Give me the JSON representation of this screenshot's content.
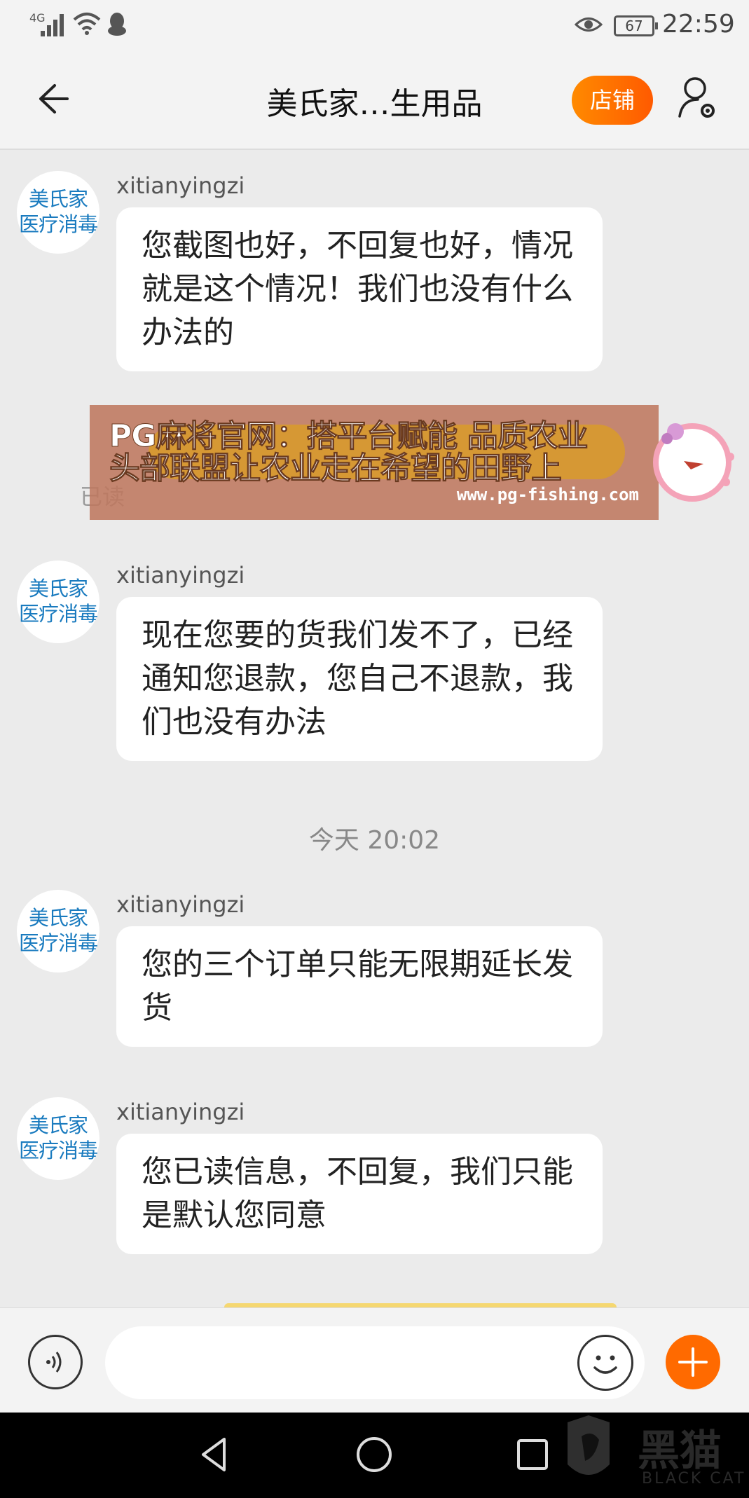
{
  "status_bar": {
    "network": "4G",
    "battery": "67",
    "time": "22:59"
  },
  "header": {
    "title": "美氏家…生用品",
    "shop_button": "店铺"
  },
  "avatar": {
    "line1": "美氏家",
    "line2": "医疗消毒"
  },
  "messages": [
    {
      "sender": "xitianyingzi",
      "text": "您截图也好，不回复也好，情况就是这个情况！我们也没有什么办法的"
    },
    {
      "sender": "xitianyingzi",
      "text": "现在您要的货我们发不了，已经通知您退款，您自己不退款，我们也没有办法"
    },
    {
      "sender": "xitianyingzi",
      "text": "您的三个订单只能无限期延长发货"
    },
    {
      "sender": "xitianyingzi",
      "text": "您已读信息，不回复，我们只能是默认您同意"
    }
  ],
  "read_status": "已读",
  "timestamp": "今天  20:02",
  "ad": {
    "line1": "PG麻将官网：搭平台赋能 品质农业",
    "line2": "头部联盟让农业走在希望的田野上",
    "url": "www.pg-fishing.com"
  },
  "input": {
    "placeholder": ""
  },
  "watermark": {
    "cn": "黑猫",
    "en": "BLACK CAT"
  },
  "colors": {
    "accent": "#ff6a00",
    "avatar_text": "#1a7bbf",
    "background": "#ebebeb"
  },
  "icons": {
    "back": "arrow-left-icon",
    "user_settings": "user-settings-icon",
    "voice": "voice-icon",
    "emoji": "emoji-icon",
    "plus": "plus-icon"
  }
}
